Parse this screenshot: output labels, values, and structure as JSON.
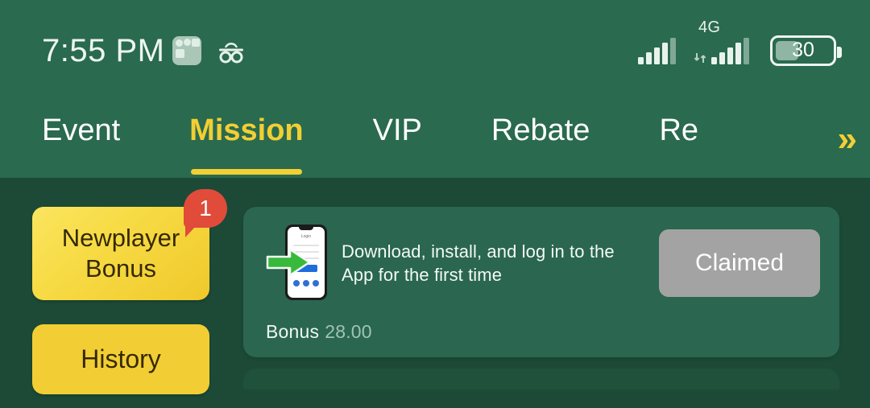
{
  "statusbar": {
    "time": "7:55 PM",
    "notification_icon": "app-grid-icon",
    "incognito_icon": "incognito-icon",
    "signal_icon": "signal-bars-icon",
    "network_type": "4G",
    "data_arrows": "⇵",
    "battery_level": "30"
  },
  "tabs": {
    "items": [
      {
        "label": "Event",
        "active": false
      },
      {
        "label": "Mission",
        "active": true
      },
      {
        "label": "VIP",
        "active": false
      },
      {
        "label": "Rebate",
        "active": false
      },
      {
        "label": "Re",
        "active": false
      }
    ],
    "more_indicator": "»"
  },
  "sidebar": {
    "items": [
      {
        "label": "Newplayer Bonus",
        "badge": "1",
        "selected": true
      },
      {
        "label": "History",
        "badge": null,
        "selected": false
      }
    ]
  },
  "missions": [
    {
      "icon": "app-download-login-icon",
      "description": "Download, install, and log in to the App for the first time",
      "action_label": "Claimed",
      "action_enabled": false,
      "bonus_label": "Bonus",
      "bonus_value": "28.00"
    }
  ],
  "colors": {
    "header_green": "#2a6a4f",
    "page_green": "#1c4a37",
    "card_green": "#2a6650",
    "accent_yellow": "#f2cf33",
    "badge_red": "#e04b3a",
    "disabled_grey": "#a3a3a3"
  }
}
